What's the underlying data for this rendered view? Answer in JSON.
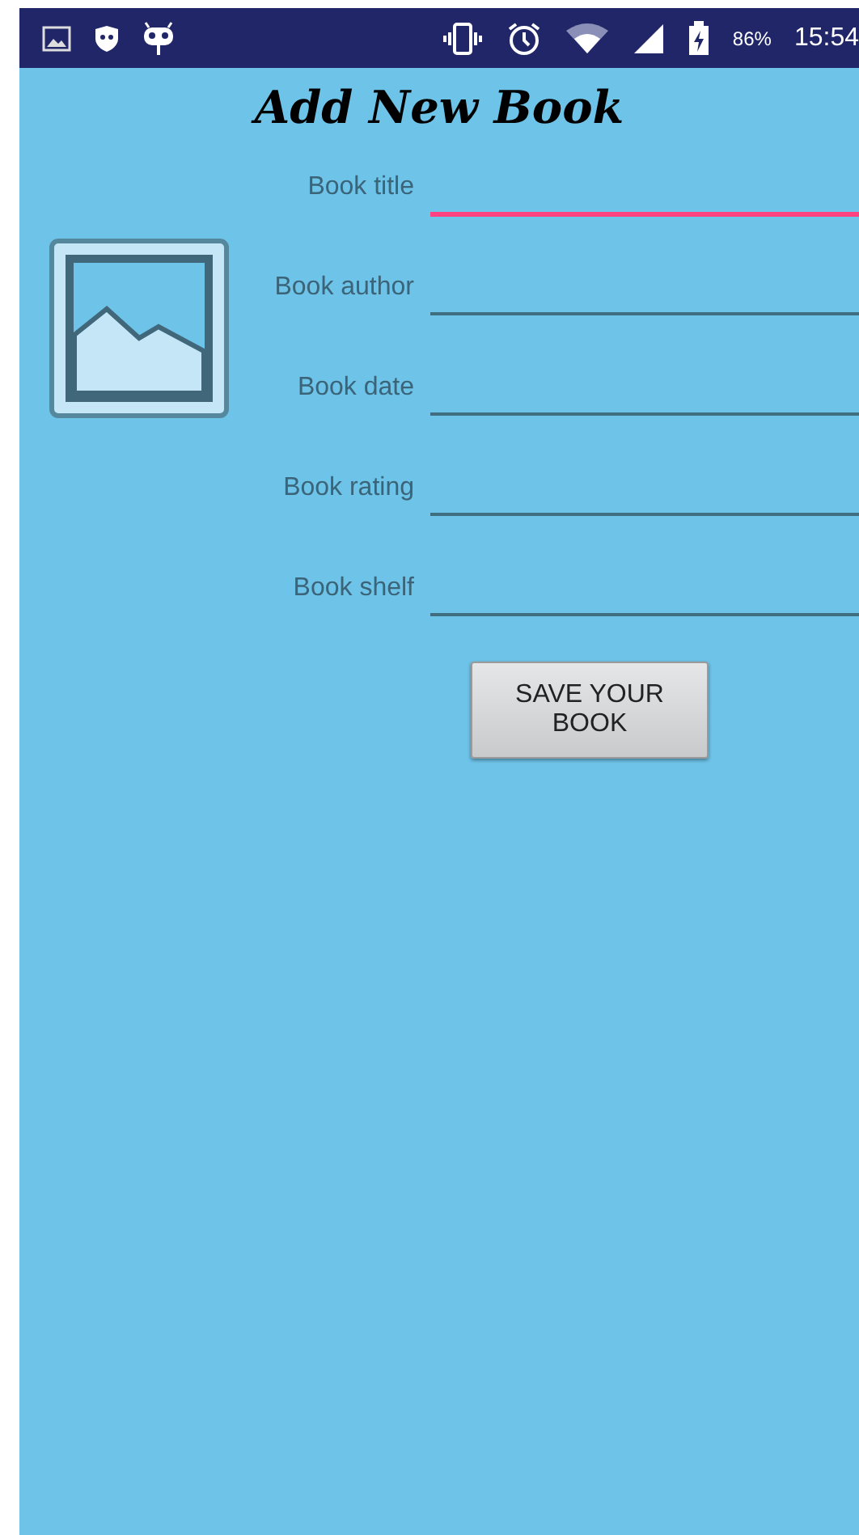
{
  "status_bar": {
    "battery": "86%",
    "time": "15:54"
  },
  "title": "Add New Book",
  "fields": [
    {
      "label": "Book title",
      "focused": true
    },
    {
      "label": "Book author",
      "focused": false
    },
    {
      "label": "Book date",
      "focused": false
    },
    {
      "label": "Book rating",
      "focused": false
    },
    {
      "label": "Book shelf",
      "focused": false
    }
  ],
  "save_button": "SAVE YOUR BOOK"
}
